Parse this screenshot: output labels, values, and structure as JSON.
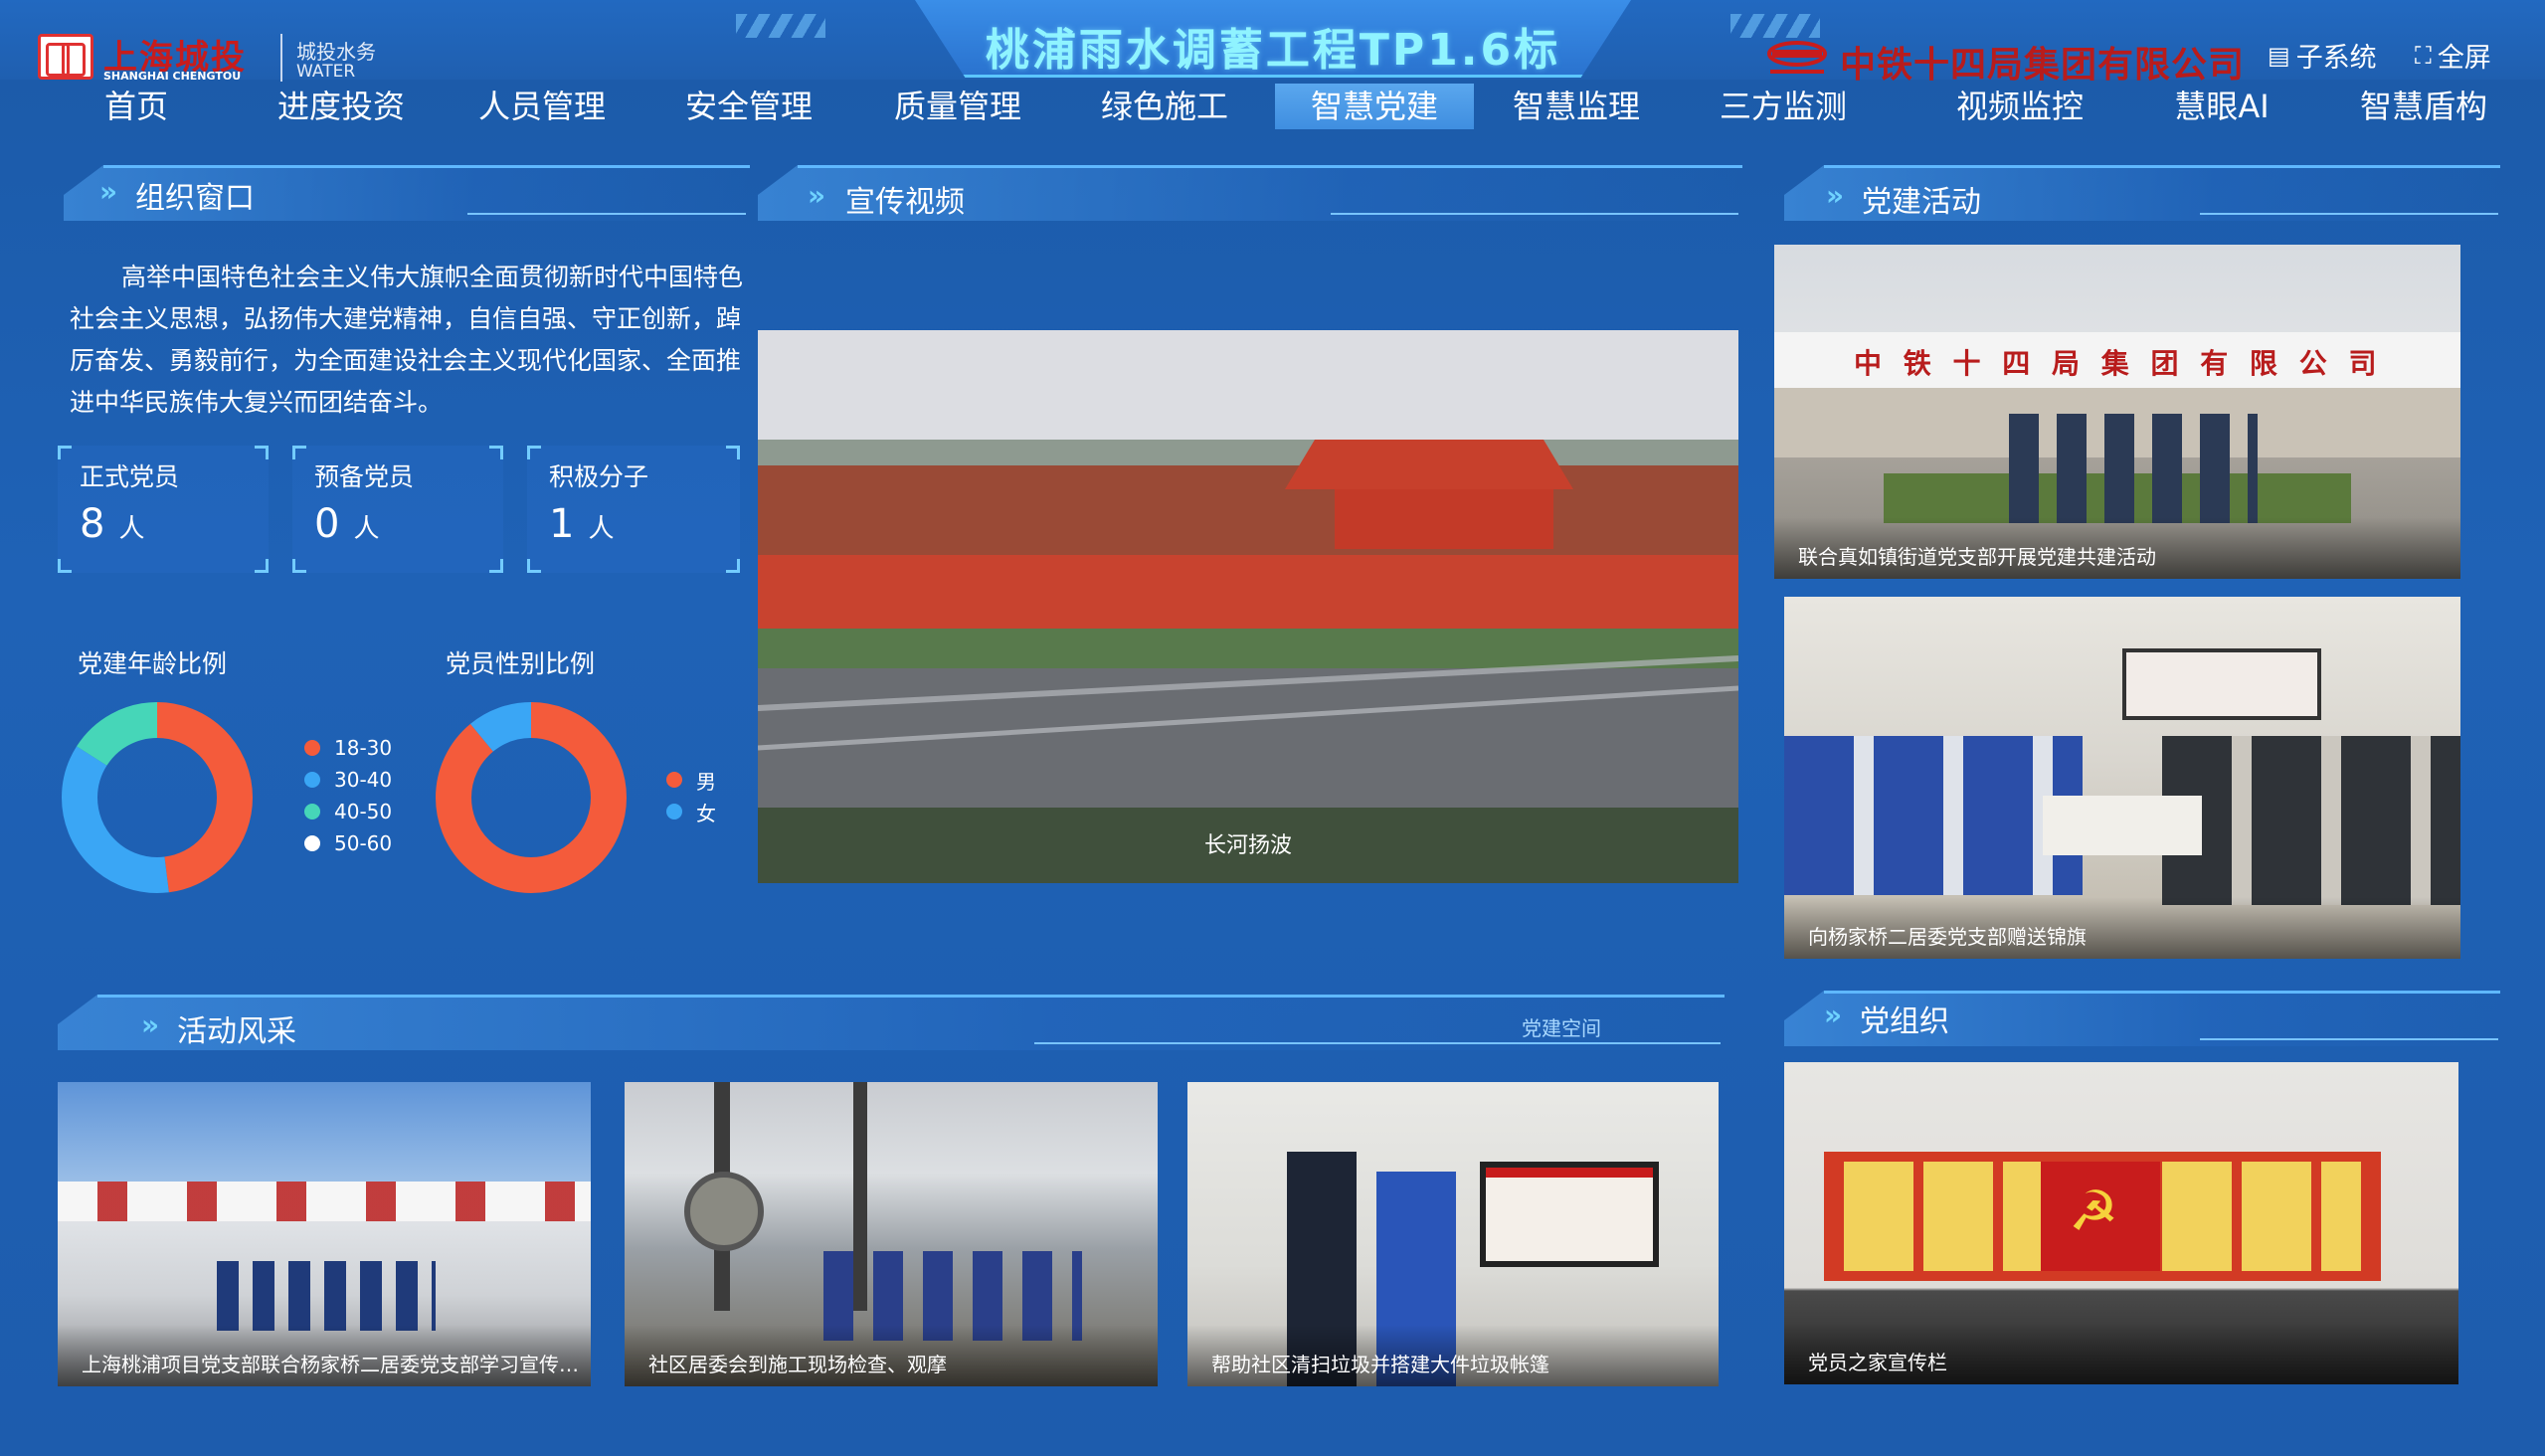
{
  "header": {
    "title": "桃浦雨水调蓄工程TP1.6标",
    "logo_cn": "上海城投",
    "logo_en": "SHANGHAI CHENGTOU",
    "logo_sub_cn": "城投水务",
    "logo_sub_en": "WATER",
    "company": "中铁十四局集团有限公司",
    "subsystem_label": "子系统",
    "fullscreen_label": "全屏"
  },
  "nav": {
    "items": [
      {
        "label": "首页"
      },
      {
        "label": "进度投资"
      },
      {
        "label": "人员管理"
      },
      {
        "label": "安全管理"
      },
      {
        "label": "质量管理"
      },
      {
        "label": "绿色施工"
      },
      {
        "label": "智慧党建"
      },
      {
        "label": "智慧监理"
      },
      {
        "label": "三方监测"
      },
      {
        "label": "视频监控"
      },
      {
        "label": "慧眼AI"
      },
      {
        "label": "智慧盾构"
      }
    ],
    "active": "智慧党建"
  },
  "org_window": {
    "title": "组织窗口",
    "text": "高举中国特色社会主义伟大旗帜全面贯彻新时代中国特色社会主义思想，弘扬伟大建党精神，自信自强、守正创新，踔厉奋发、勇毅前行，为全面建设社会主义现代化国家、全面推进中华民族伟大复兴而团结奋斗。",
    "stats": [
      {
        "label": "正式党员",
        "value": "8",
        "unit": "人"
      },
      {
        "label": "预备党员",
        "value": "0",
        "unit": "人"
      },
      {
        "label": "积极分子",
        "value": "1",
        "unit": "人"
      }
    ],
    "age_chart_title": "党建年龄比例",
    "gender_chart_title": "党员性别比例"
  },
  "chart_data": [
    {
      "type": "pie",
      "title": "党建年龄比例",
      "categories": [
        "18-30",
        "30-40",
        "40-50",
        "50-60"
      ],
      "values": [
        0.48,
        0.36,
        0.16,
        0.0
      ],
      "colors": [
        "#f45b3b",
        "#3aa6f5",
        "#46d6b8",
        "#ffffff"
      ]
    },
    {
      "type": "pie",
      "title": "党员性别比例",
      "categories": [
        "男",
        "女"
      ],
      "values": [
        0.89,
        0.11
      ],
      "colors": [
        "#f45b3b",
        "#3aa6f5"
      ]
    }
  ],
  "video": {
    "title": "宣传视频",
    "caption": "长河扬波"
  },
  "party_activities": {
    "title": "党建活动",
    "items": [
      {
        "caption": "联合真如镇街道党支部开展党建共建活动",
        "sign": "中 铁 十 四 局 集 团 有 限 公 司"
      },
      {
        "caption": "向杨家桥二居委党支部赠送锦旗"
      }
    ]
  },
  "activity_gallery": {
    "title": "活动风采",
    "link": "党建空间",
    "items": [
      {
        "caption": "上海桃浦项目党支部联合杨家桥二居委党支部学习宣传贯..."
      },
      {
        "caption": "社区居委会到施工现场检查、观摩"
      },
      {
        "caption": "帮助社区清扫垃圾并搭建大件垃圾帐篷"
      }
    ]
  },
  "party_org": {
    "title": "党组织",
    "items": [
      {
        "caption": "党员之家宣传栏"
      }
    ]
  },
  "colors": {
    "background": "#1f5fb0",
    "accent": "#5fb8ff",
    "title_text": "#8ff3ff",
    "company_red": "#b81c1c"
  }
}
